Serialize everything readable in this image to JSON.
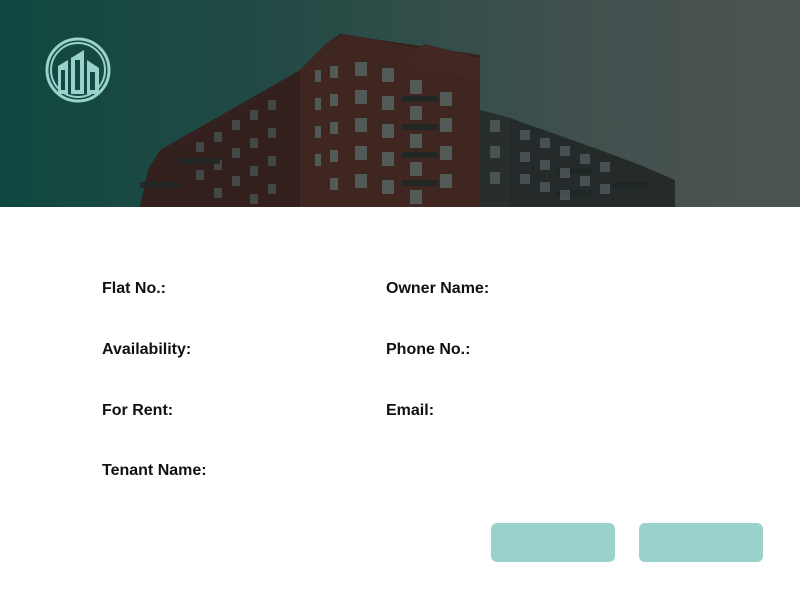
{
  "header": {
    "logo_icon": "buildings-icon",
    "accent": "#98d2cb"
  },
  "form": {
    "left_column": [
      {
        "label": "Flat No.:"
      },
      {
        "label": "Availability:"
      },
      {
        "label": "For Rent:"
      },
      {
        "label": "Tenant Name:"
      }
    ],
    "right_column": [
      {
        "label": "Owner Name:"
      },
      {
        "label": "Phone No.:"
      },
      {
        "label": "Email:"
      }
    ]
  },
  "actions": {
    "primary_label": "",
    "secondary_label": "",
    "button_color": "#98d2cb"
  }
}
